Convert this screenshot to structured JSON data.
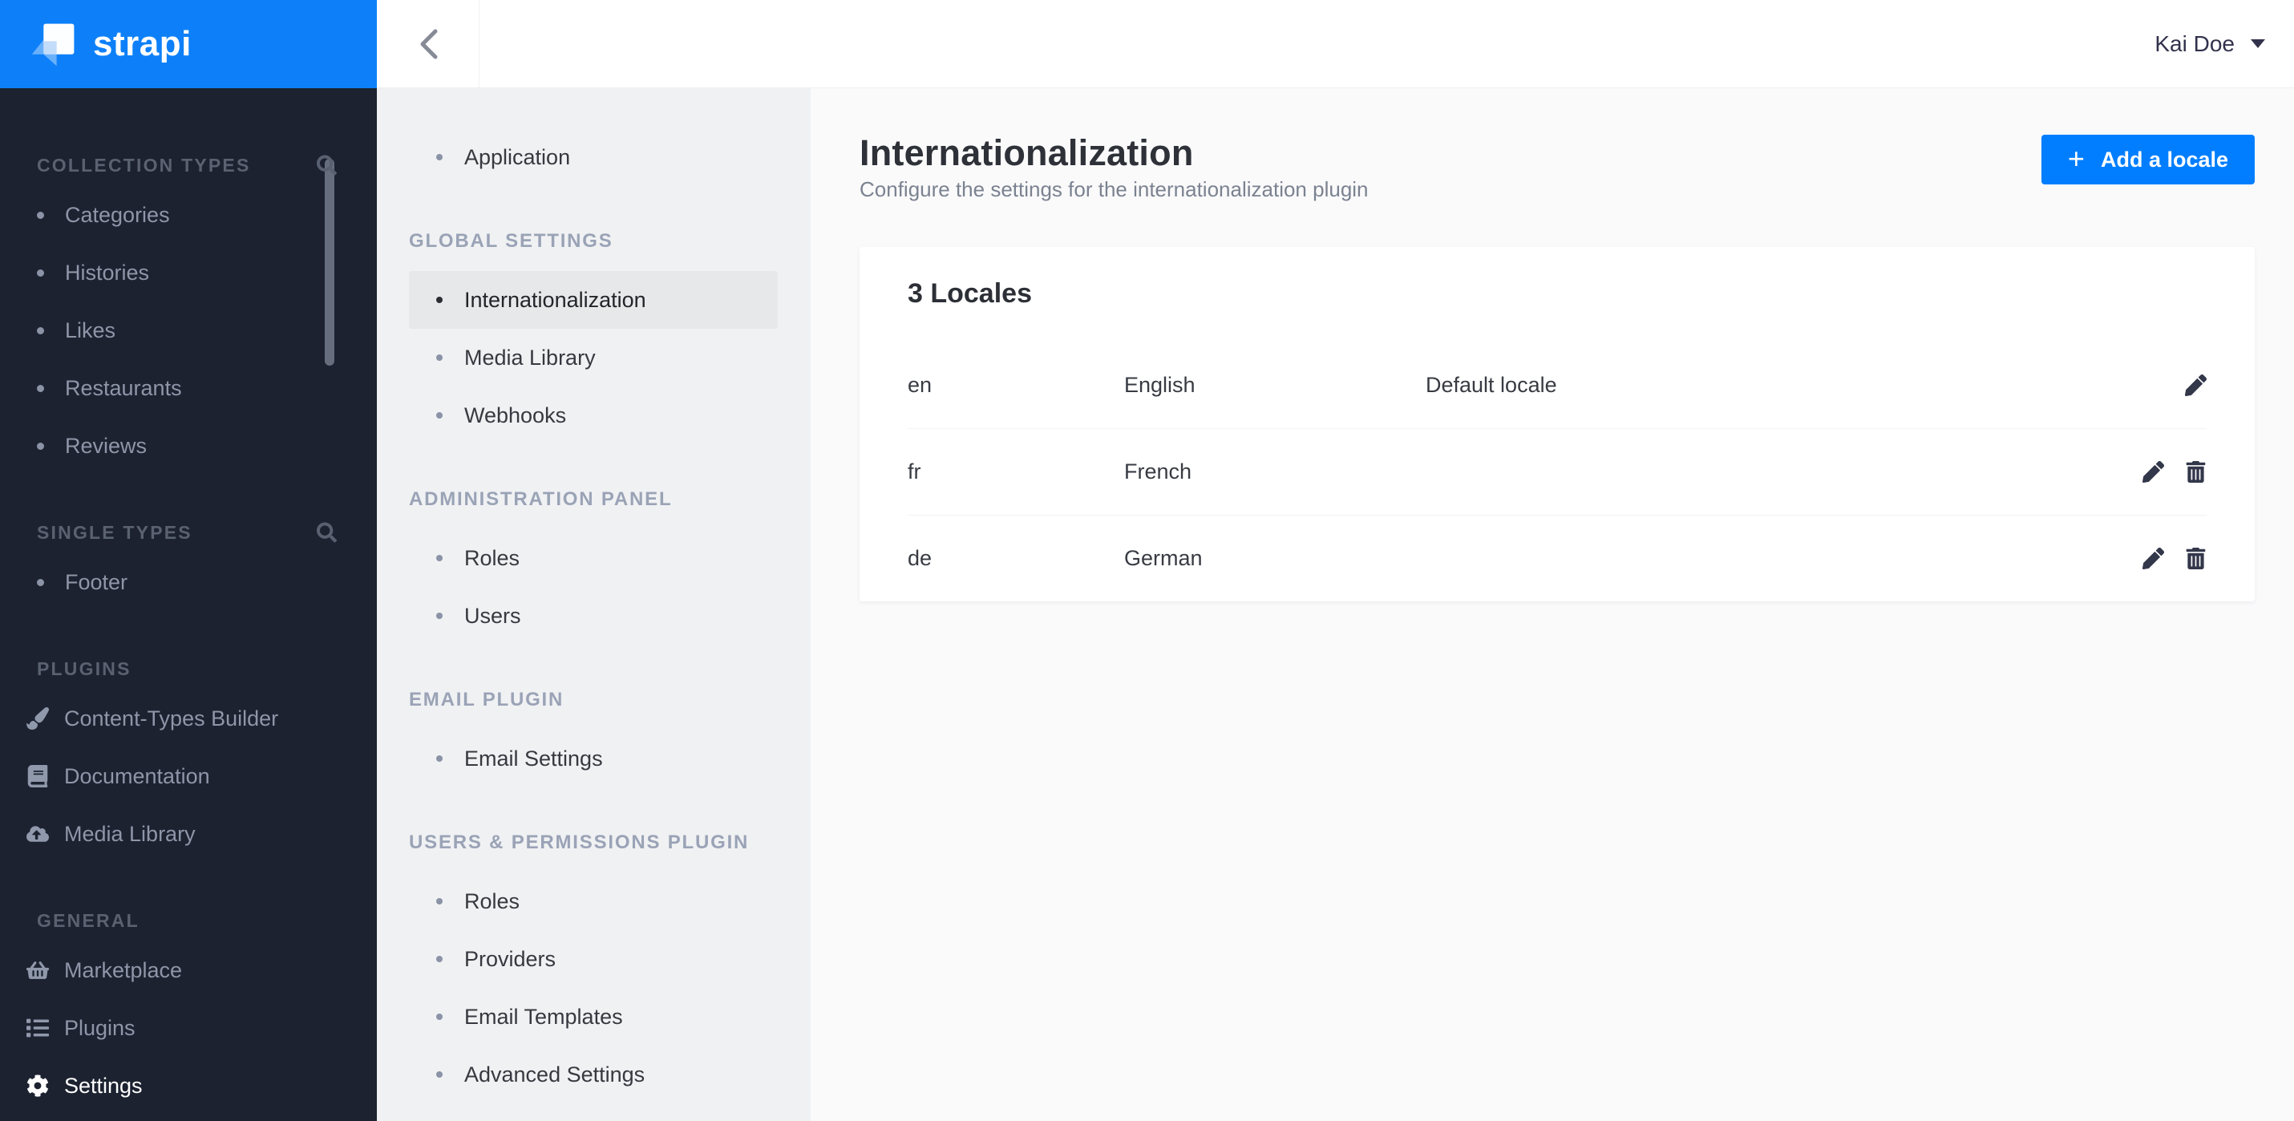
{
  "brand": {
    "name": "strapi"
  },
  "topbar": {
    "user": "Kai Doe"
  },
  "dark_sidebar": {
    "sections": [
      {
        "label": "COLLECTION TYPES",
        "has_search": true,
        "items": [
          {
            "label": "Categories"
          },
          {
            "label": "Histories"
          },
          {
            "label": "Likes"
          },
          {
            "label": "Restaurants"
          },
          {
            "label": "Reviews"
          }
        ]
      },
      {
        "label": "SINGLE TYPES",
        "has_search": true,
        "items": [
          {
            "label": "Footer"
          }
        ]
      },
      {
        "label": "PLUGINS",
        "has_search": false,
        "items": [
          {
            "label": "Content-Types Builder",
            "icon": "paintbrush-icon"
          },
          {
            "label": "Documentation",
            "icon": "book-icon"
          },
          {
            "label": "Media Library",
            "icon": "cloud-upload-icon"
          }
        ]
      },
      {
        "label": "GENERAL",
        "has_search": false,
        "items": [
          {
            "label": "Marketplace",
            "icon": "basket-icon"
          },
          {
            "label": "Plugins",
            "icon": "list-icon"
          },
          {
            "label": "Settings",
            "icon": "gear-icon",
            "active": true
          }
        ]
      }
    ]
  },
  "settings_sidebar": {
    "sections": [
      {
        "label": "",
        "items": [
          {
            "label": "Application"
          }
        ]
      },
      {
        "label": "GLOBAL SETTINGS",
        "items": [
          {
            "label": "Internationalization",
            "selected": true
          },
          {
            "label": "Media Library"
          },
          {
            "label": "Webhooks"
          }
        ]
      },
      {
        "label": "ADMINISTRATION PANEL",
        "items": [
          {
            "label": "Roles"
          },
          {
            "label": "Users"
          }
        ]
      },
      {
        "label": "EMAIL PLUGIN",
        "items": [
          {
            "label": "Email Settings"
          }
        ]
      },
      {
        "label": "USERS & PERMISSIONS PLUGIN",
        "items": [
          {
            "label": "Roles"
          },
          {
            "label": "Providers"
          },
          {
            "label": "Email Templates"
          },
          {
            "label": "Advanced Settings"
          }
        ]
      }
    ]
  },
  "main": {
    "title": "Internationalization",
    "subtitle": "Configure the settings for the internationalization plugin",
    "add_button_label": "Add a locale",
    "plus_glyph": "+",
    "card": {
      "heading": "3 Locales",
      "rows": [
        {
          "code": "en",
          "name": "English",
          "status": "Default locale",
          "can_delete": false
        },
        {
          "code": "fr",
          "name": "French",
          "status": "",
          "can_delete": true
        },
        {
          "code": "de",
          "name": "German",
          "status": "",
          "can_delete": true
        }
      ]
    }
  },
  "colors": {
    "accent": "#007eff",
    "brand_bg": "#0d80f9",
    "dark_sidebar_bg": "#1c2230",
    "dark_item_text": "#8e96a8",
    "light_sidebar_bg": "#f0f1f3",
    "selected_item_bg": "#e7e8ea",
    "main_bg": "#fafafb",
    "heading_text": "#2e3138",
    "muted_text": "#7b8290",
    "icon_ink": "#33374a"
  }
}
